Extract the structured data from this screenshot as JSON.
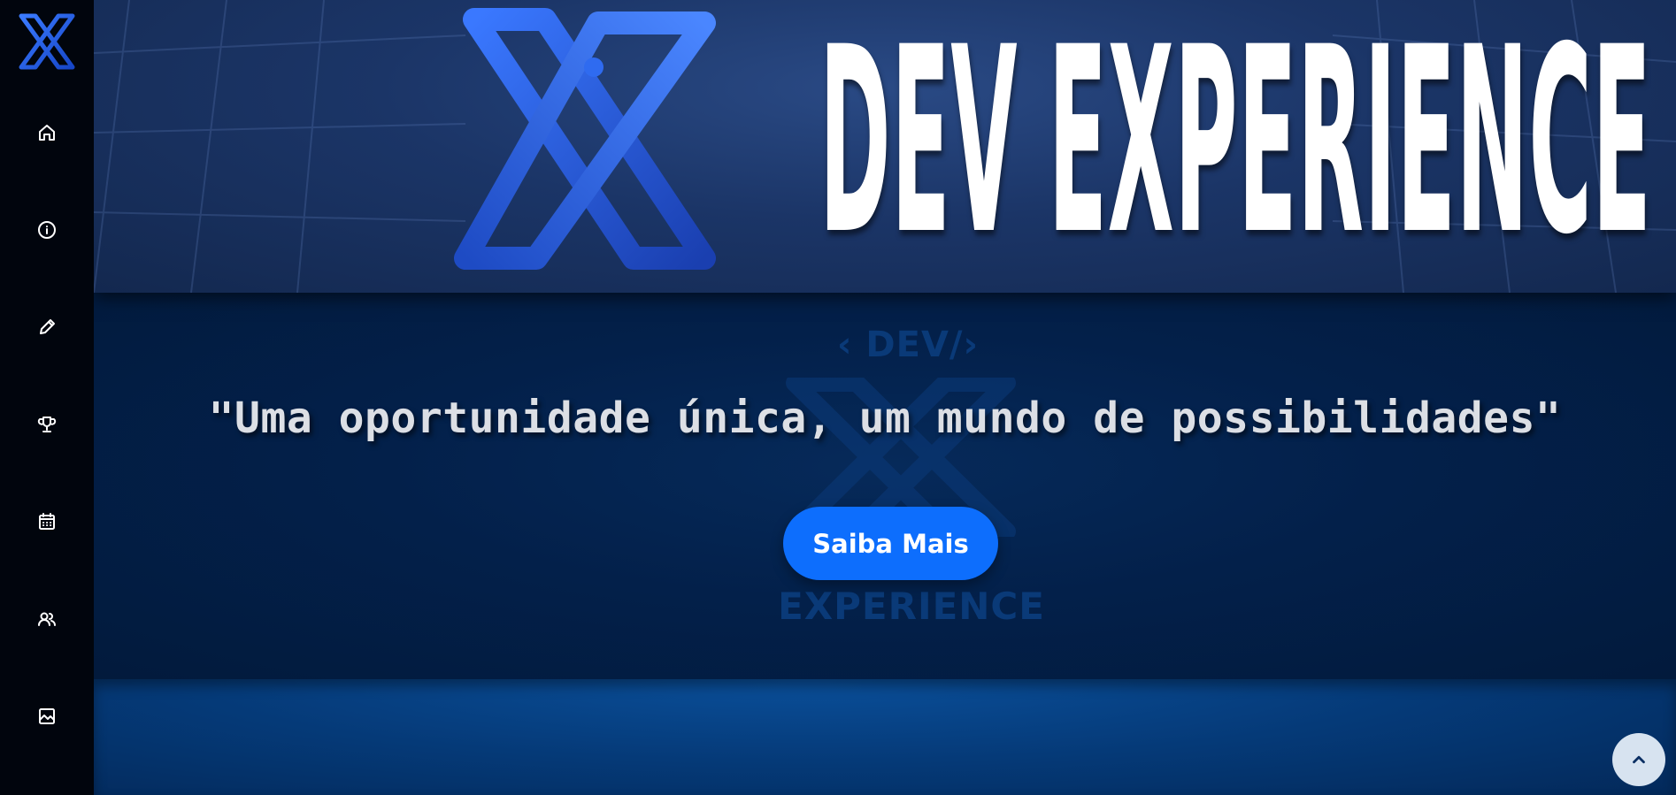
{
  "sidebar": {
    "items": [
      {
        "id": "home",
        "icon": "home-icon"
      },
      {
        "id": "about",
        "icon": "info-icon"
      },
      {
        "id": "register",
        "icon": "pencil-icon"
      },
      {
        "id": "awards",
        "icon": "trophy-icon"
      },
      {
        "id": "schedule",
        "icon": "calendar-icon"
      },
      {
        "id": "team",
        "icon": "users-icon"
      },
      {
        "id": "gallery",
        "icon": "image-icon"
      }
    ]
  },
  "banner": {
    "title": "DEV EXPERIENCE"
  },
  "hero": {
    "watermark_top": "‹ DEV/›",
    "watermark_bottom": "EXPERIENCE",
    "tagline": "\"Uma oportunidade única, um mundo de possibilidades\"",
    "cta_label": "Saiba Mais"
  },
  "colors": {
    "accent": "#0d6efd",
    "sidebar_bg": "#01050d",
    "hero_bg": "#021a3c"
  }
}
